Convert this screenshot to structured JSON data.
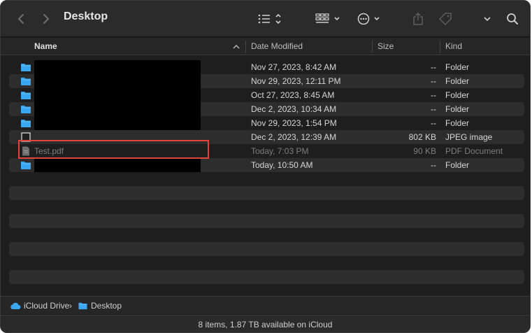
{
  "window": {
    "title": "Desktop"
  },
  "toolbar": {
    "back_icon": "chevron-left-icon",
    "forward_icon": "chevron-right-icon",
    "view_icon": "list-view-icon",
    "group_icon": "grid-group-icon",
    "action_icon": "ellipsis-circle-icon",
    "share_icon": "share-icon",
    "tag_icon": "tag-icon",
    "more_icon": "chevron-down-icon",
    "search_icon": "magnifying-glass-icon"
  },
  "columns": {
    "name": "Name",
    "date_modified": "Date Modified",
    "size": "Size",
    "kind": "Kind"
  },
  "files": [
    {
      "name": "",
      "date": "Nov 27, 2023, 8:42 AM",
      "size": "--",
      "kind": "Folder",
      "icon": "folder"
    },
    {
      "name": "",
      "date": "Nov 29, 2023, 12:11 PM",
      "size": "--",
      "kind": "Folder",
      "icon": "folder"
    },
    {
      "name": "",
      "date": "Oct 27, 2023, 8:45 AM",
      "size": "--",
      "kind": "Folder",
      "icon": "folder"
    },
    {
      "name": "",
      "date": "Dec 2, 2023, 10:34 AM",
      "size": "--",
      "kind": "Folder",
      "icon": "folder"
    },
    {
      "name": "",
      "date": "Nov 29, 2023, 1:54 PM",
      "size": "--",
      "kind": "Folder",
      "icon": "folder"
    },
    {
      "name": "",
      "date": "Dec 2, 2023, 12:39 AM",
      "size": "802 KB",
      "kind": "JPEG image",
      "icon": "image"
    },
    {
      "name": "Test.pdf",
      "date": "Today, 7:03 PM",
      "size": "90 KB",
      "kind": "PDF Document",
      "icon": "document"
    },
    {
      "name": "",
      "date": "Today, 10:50 AM",
      "size": "--",
      "kind": "Folder",
      "icon": "folder"
    }
  ],
  "path": {
    "root": "iCloud Drive",
    "separator": "›",
    "current": "Desktop"
  },
  "status": {
    "text": "8 items, 1.87 TB available on iCloud"
  },
  "colors": {
    "folder_blue": "#3ba7f0",
    "highlight_red": "#e0443a",
    "background": "#1e1e1e"
  }
}
